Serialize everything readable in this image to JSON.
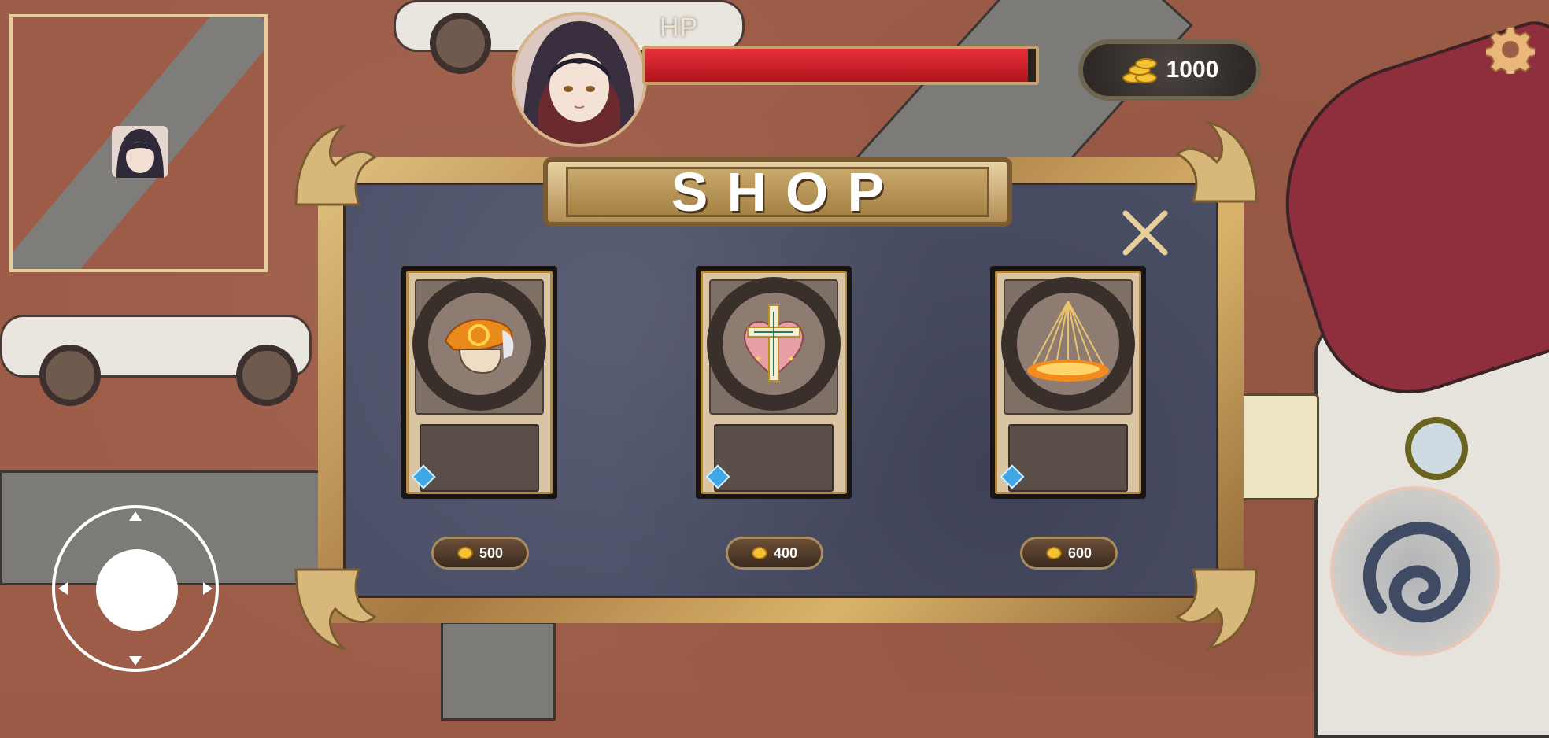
{
  "hud": {
    "hp_label": "HP",
    "hp_fraction": 0.98,
    "gold_amount": "1000"
  },
  "shop": {
    "title": "SHOP",
    "items": [
      {
        "icon": "fist-gauntlet-icon",
        "price": "500"
      },
      {
        "icon": "holy-cross-heart-icon",
        "price": "400"
      },
      {
        "icon": "golden-light-rays-icon",
        "price": "600"
      }
    ]
  },
  "colors": {
    "hp": "#d7232b",
    "gold": "#f3c235",
    "panel": "#4c5068",
    "frame": "#c9a060"
  }
}
